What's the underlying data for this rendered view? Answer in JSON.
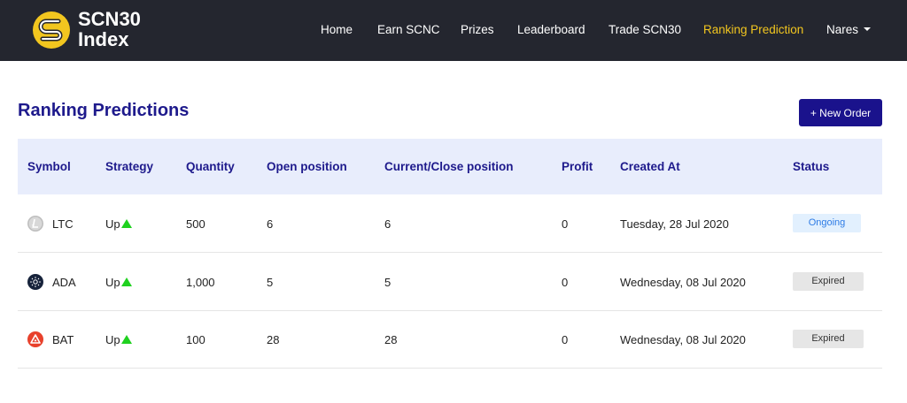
{
  "navbar": {
    "brand_line1": "SCN30",
    "brand_line2": "Index",
    "items": [
      {
        "label": "Home"
      },
      {
        "label": "Earn SCNC"
      },
      {
        "label": "Prizes"
      },
      {
        "label": "Leaderboard"
      },
      {
        "label": "Trade SCN30"
      },
      {
        "label": "Ranking Prediction",
        "active": true
      },
      {
        "label": "Nares"
      }
    ],
    "active_color": "#f2c61f",
    "background": "#24262f"
  },
  "page": {
    "title": "Ranking Predictions",
    "new_order_label": "+ New Order"
  },
  "table": {
    "headers": [
      "Symbol",
      "Strategy",
      "Quantity",
      "Open position",
      "Current/Close position",
      "Profit",
      "Created At",
      "Status"
    ],
    "rows": [
      {
        "icon": "litecoin-icon",
        "symbol": "LTC",
        "strategy": "Up",
        "quantity": "500",
        "open": "6",
        "current": "6",
        "profit": "0",
        "created": "Tuesday, 28 Jul 2020",
        "status": "Ongoing"
      },
      {
        "icon": "cardano-icon",
        "symbol": "ADA",
        "strategy": "Up",
        "quantity": "1,000",
        "open": "5",
        "current": "5",
        "profit": "0",
        "created": "Wednesday, 08 Jul 2020",
        "status": "Expired"
      },
      {
        "icon": "bat-icon",
        "symbol": "BAT",
        "strategy": "Up",
        "quantity": "100",
        "open": "28",
        "current": "28",
        "profit": "0",
        "created": "Wednesday, 08 Jul 2020",
        "status": "Expired"
      }
    ]
  }
}
